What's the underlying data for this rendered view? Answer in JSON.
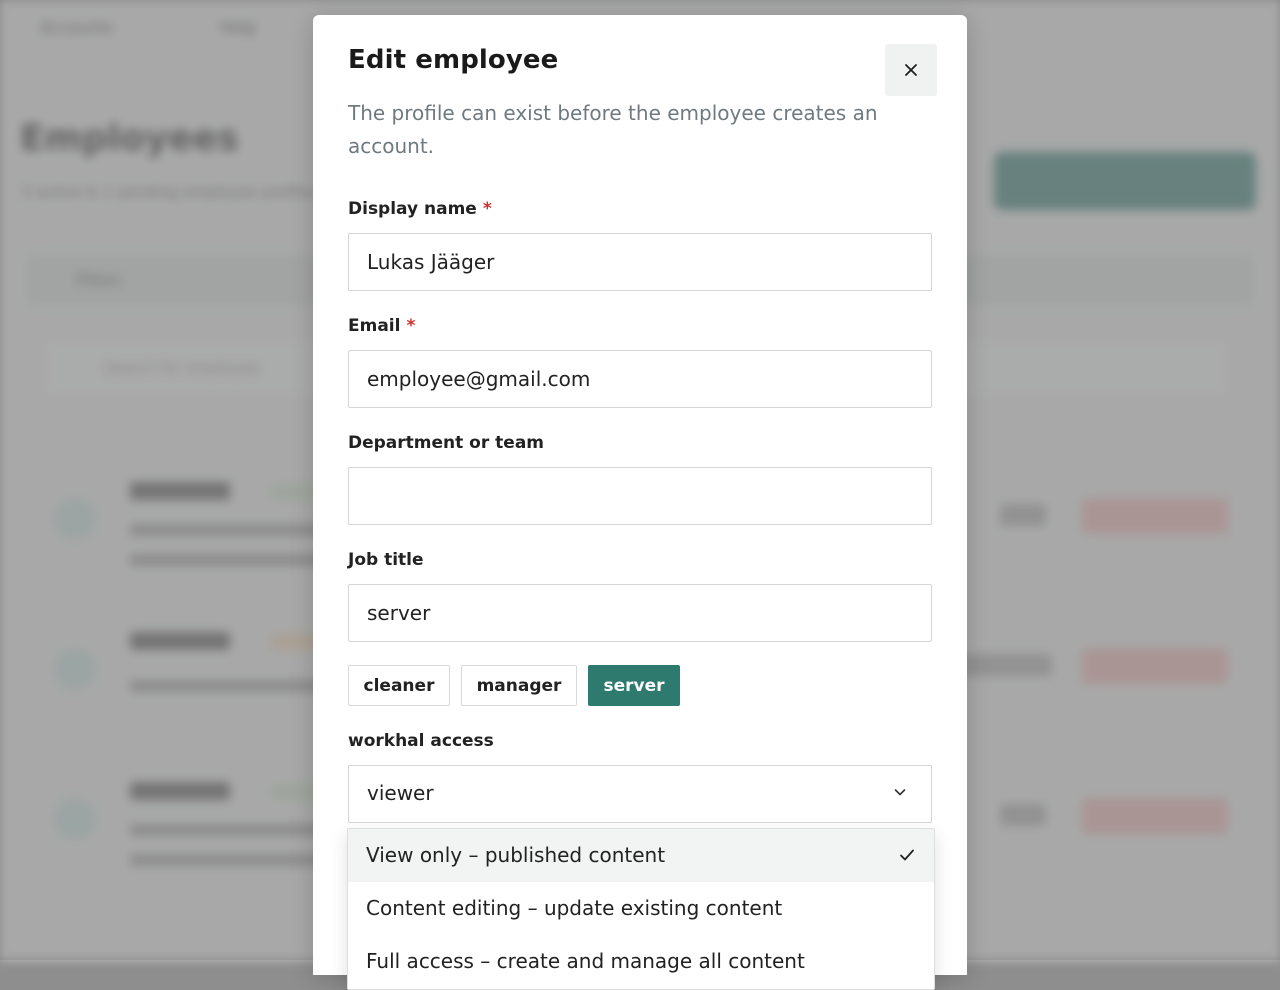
{
  "background": {
    "nav": [
      "Accounts",
      "Help"
    ],
    "title": "Employees",
    "subtitle": "3 active & 1 pending employee profiles",
    "filters_label": "Filters",
    "search_placeholder": "Search for employee"
  },
  "modal": {
    "title": "Edit employee",
    "description": "The profile can exist before the employee creates an account.",
    "close_label": "×",
    "required_marker": "*",
    "fields": {
      "display_name": {
        "label": "Display name",
        "value": "Lukas Jääger",
        "required": true
      },
      "email": {
        "label": "Email",
        "value": "employee@gmail.com",
        "required": true
      },
      "department": {
        "label": "Department or team",
        "value": ""
      },
      "job_title": {
        "label": "Job title",
        "value": "server"
      }
    },
    "job_title_suggestions": [
      "cleaner",
      "manager",
      "server"
    ],
    "selected_suggestion": "server",
    "access": {
      "label": "workhal access",
      "value": "viewer",
      "options": [
        "View only – published content",
        "Content editing – update existing content",
        "Full access – create and manage all content"
      ],
      "selected_index": 0
    }
  },
  "colors": {
    "accent": "#2e7a6f",
    "required": "#d0312d",
    "muted_text": "#6f7a80"
  },
  "icons": {
    "close": "close-icon",
    "chevron": "chevron-down-icon",
    "check": "check-icon"
  }
}
